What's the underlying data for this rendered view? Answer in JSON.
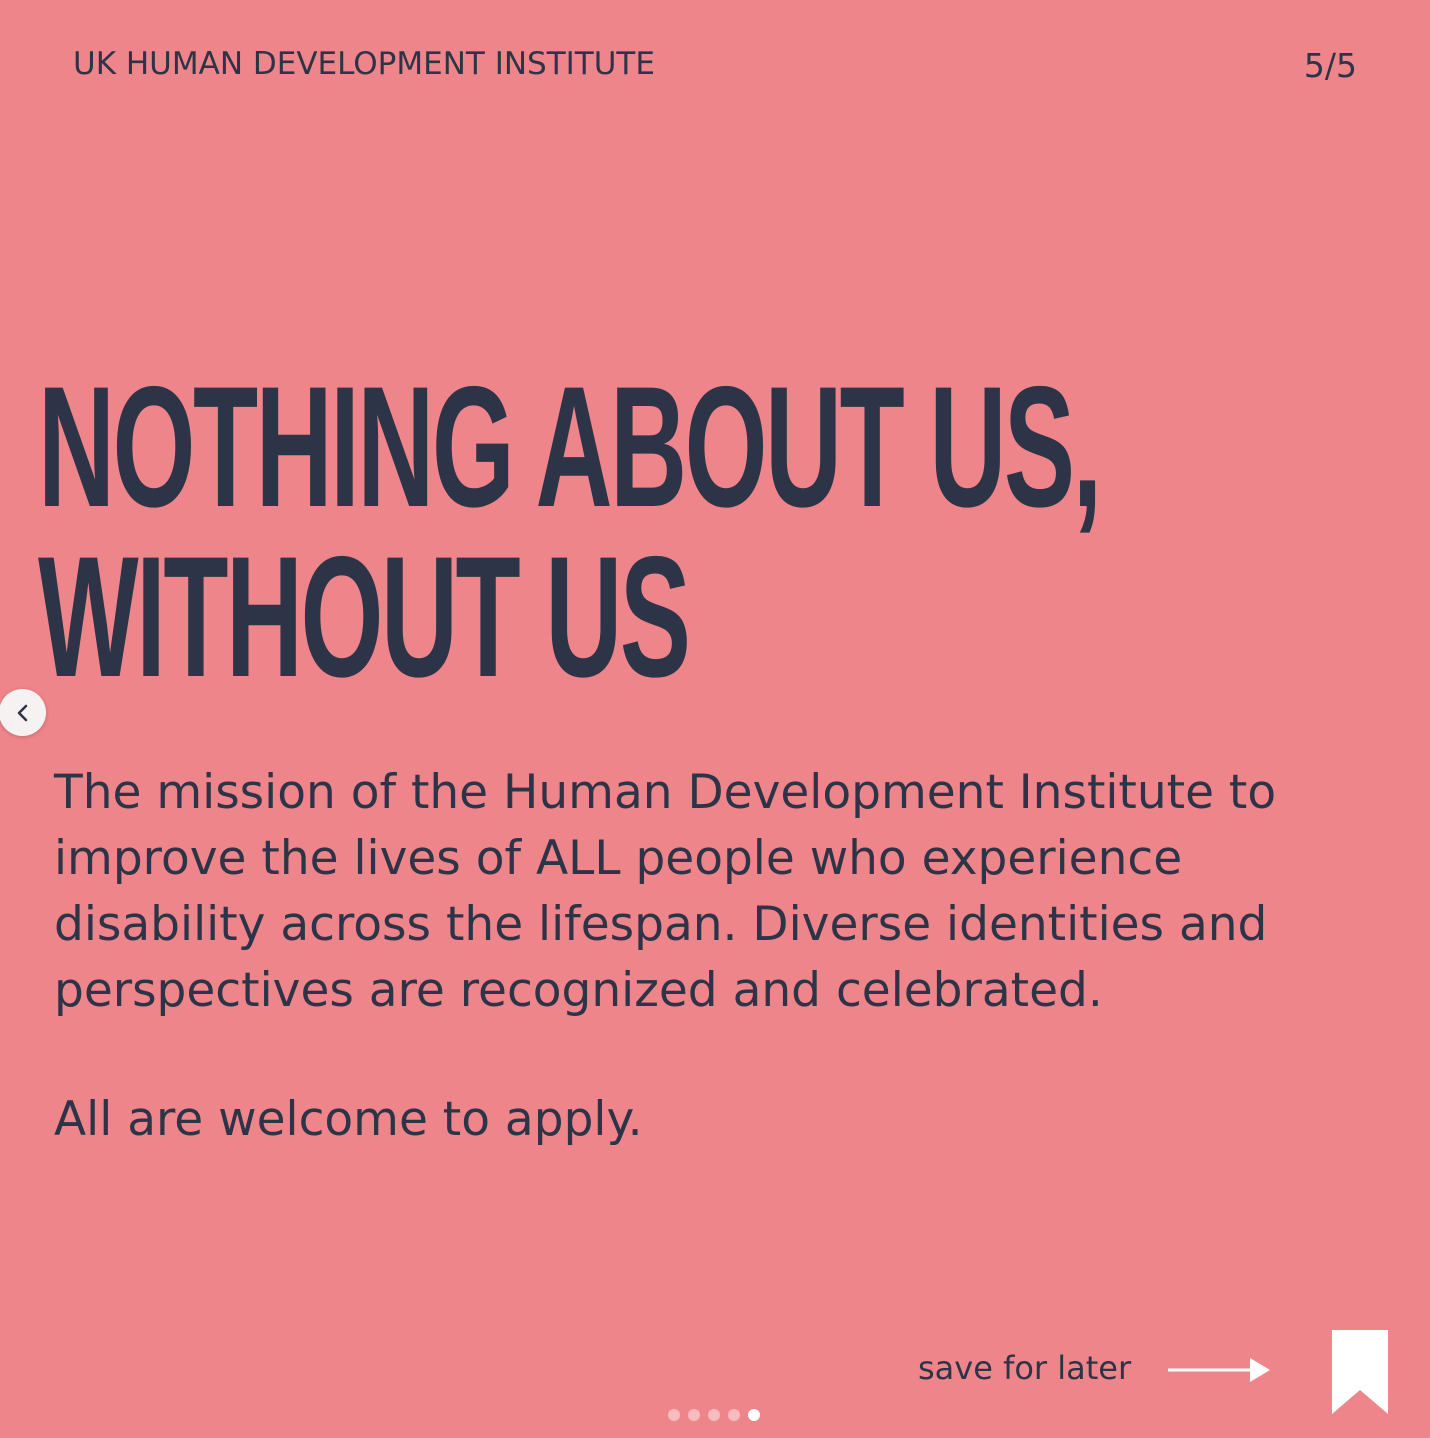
{
  "header": {
    "org_name": "UK HUMAN DEVELOPMENT INSTITUTE",
    "page_counter": "5/5"
  },
  "headline": {
    "line1": "NOTHING ABOUT US,",
    "line2": "WITHOUT US"
  },
  "body": {
    "mission": "The mission of the Human Development Institute to improve the lives of ALL people who experience disability across the lifespan. Diverse identities and perspectives are recognized and celebrated.",
    "welcome": "All are welcome to apply."
  },
  "footer": {
    "save_label": "save for later"
  },
  "carousel": {
    "total_slides": 5,
    "active_slide": 5
  },
  "icons": {
    "prev": "chevron-left-icon",
    "arrow": "arrow-right-icon",
    "bookmark": "bookmark-icon"
  },
  "colors": {
    "background": "#ee858a",
    "text": "#2e3447",
    "accent": "#ffffff"
  }
}
